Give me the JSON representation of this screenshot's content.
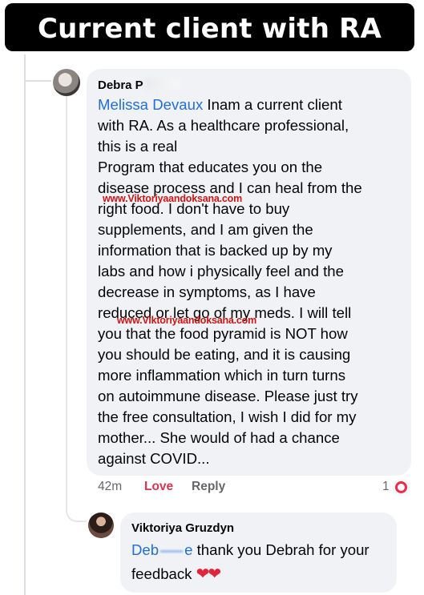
{
  "banner": {
    "title": "Current client with RA"
  },
  "comment": {
    "author": "Debra P",
    "mention": "Melissa Devaux",
    "text": " Inam a current client\nwith RA.  As a healthcare professional,\nthis is a real\nProgram that educates you on the\ndisease process and I can heal from the\nright food. I don't have to buy\nsupplements, and I am given the\ninformation that is backed up by my\nlabs and how i physically feel and the\ndecrease in symptoms, as I have\nreduced or let go of my meds.  I will tell\nyou that the food pyramid is NOT how\nyou should be eating, and it is causing\nmore inflammation which in turn turns\non autoimmune disease.  Please just try\nthe free consultation, I wish I did for my\nmother... She would of had a chance\nagainst COVID...",
    "watermark": "www.Viktoriyaandoksana.com",
    "time": "42m",
    "love_label": "Love",
    "reply_label": "Reply",
    "reaction_count": "1",
    "reaction_icon": "love-reaction-icon"
  },
  "reply": {
    "author": "Viktoriya Gruzdyn",
    "mention_start": "Deb",
    "mention_end": "e",
    "text": " thank you Debrah for your feedback ",
    "hearts": "❤❤"
  },
  "colors": {
    "mention": "#216fdb",
    "love": "#d8334f",
    "watermark": "#d11414",
    "bubble": "#f0f2f5"
  }
}
